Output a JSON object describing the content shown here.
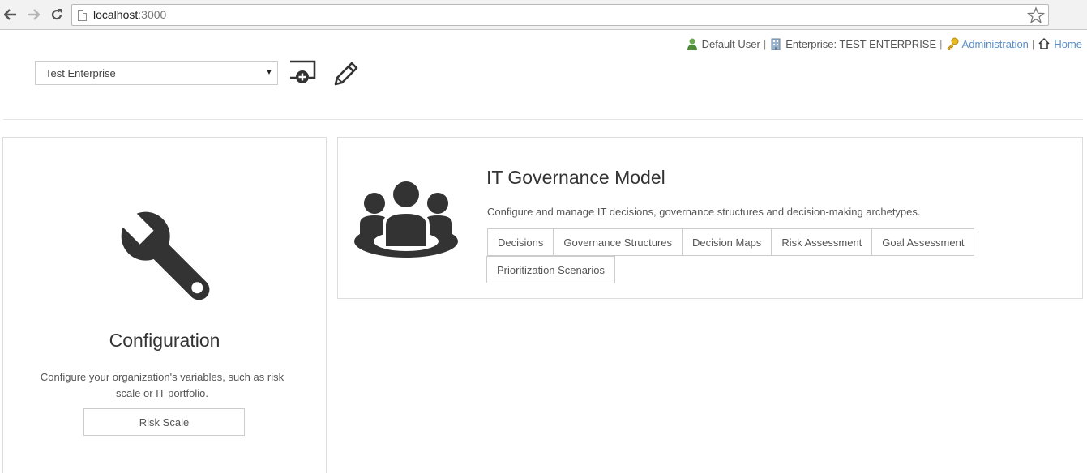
{
  "browser": {
    "url_host": "localhost",
    "url_port": ":3000"
  },
  "userbar": {
    "user": "Default User",
    "enterprise": "Enterprise: TEST ENTERPRISE",
    "administration": "Administration",
    "home": "Home",
    "separator": "|"
  },
  "enterprise_select": {
    "value": "Test Enterprise"
  },
  "config_card": {
    "title": "Configuration",
    "description": "Configure your organization's variables, such as risk scale or IT portfolio.",
    "button": "Risk Scale"
  },
  "governance_card": {
    "title": "IT Governance Model",
    "description": "Configure and manage IT decisions, governance structures and decision-making archetypes.",
    "links": [
      "Decisions",
      "Governance Structures",
      "Decision Maps",
      "Risk Assessment",
      "Goal Assessment",
      "Prioritization Scenarios"
    ]
  },
  "colors": {
    "link": "#5b8fc9",
    "icon_dark": "#333333",
    "border": "#dddddd"
  }
}
